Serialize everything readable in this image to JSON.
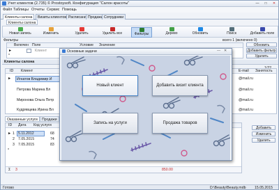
{
  "window": {
    "title": "Учет клиентов (2.735) © Prostoysoft. Конфигурация \"Салон красоты\"",
    "minimize": "—",
    "maximize": "□",
    "close": "✕"
  },
  "menu": [
    "Файл",
    "Таблицы",
    "Отчеты",
    "Сервис",
    "Помощь"
  ],
  "tabs": [
    "Клиенты салона",
    "Визиты клиентов",
    "Расписание",
    "Продажи",
    "Сотрудники"
  ],
  "subtabs": [
    "Клиенты салона"
  ],
  "toolbar": [
    {
      "label": "Новая запись",
      "icon": "new-record-icon",
      "color": "#4caf50"
    },
    {
      "label": "Изменить",
      "icon": "edit-icon",
      "color": "#e6a23c"
    },
    {
      "label": "Удалить",
      "icon": "delete-icon",
      "color": "#e53935"
    },
    {
      "label": "Удалить все",
      "icon": "delete-all-icon",
      "color": "#c62828"
    },
    {
      "label": "Фильтры",
      "icon": "filter-icon",
      "color": "#2e7d32"
    },
    {
      "label": "Дерево",
      "icon": "tree-icon",
      "color": "#43a047"
    },
    {
      "label": "Обновить",
      "icon": "refresh-icon",
      "color": "#1e88e5"
    },
    {
      "label": "Поиск",
      "icon": "search-icon",
      "color": "#546e7a"
    },
    {
      "label": "Добавить поле",
      "icon": "add-field-icon",
      "color": "#3949ab"
    }
  ],
  "filters": {
    "label": "Фильтры",
    "columns": [
      "Включен",
      "Поле",
      "Условие",
      "Значение"
    ],
    "row": {
      "field": "Клиент"
    },
    "count_text": "всего 1 (включено 0)",
    "update_btn": "Обновить",
    "add_btn": "Добавить фильтр",
    "delete_btn": "Удалить"
  },
  "clients": {
    "label": "Клиенты салона",
    "page": "1/22",
    "columns": [
      "ID",
      "Клиент",
      "E-mail",
      "Занятость"
    ],
    "rows": [
      {
        "name": "Игнатов Владимир И",
        "email": "@mail.ru"
      },
      {
        "name": "Петрова Марина Вл",
        "email": "@mail.ru"
      },
      {
        "name": "Миронова Ольга Петр",
        "email": "@mail.ru"
      },
      {
        "name": "Кудрявцева Ирина Вл",
        "email": "@mail.ru"
      }
    ]
  },
  "services": {
    "tabs": [
      "Оказанные услуги",
      "Продажи"
    ],
    "columns": [
      "ID",
      "Дата",
      "Код услуги"
    ],
    "rows": [
      {
        "id": "1",
        "date": "5.11.2012",
        "code": "68"
      },
      {
        "id": "2",
        "date": "7.05.2015",
        "code": "74"
      },
      {
        "id": "3",
        "date": "7.05.2015",
        "code": "83"
      }
    ],
    "sum_label": "Σ",
    "sum_count": "3",
    "sum_value": "850.00",
    "add_btn": "Добавить",
    "edit_btn": "Изменить",
    "delete_btn": "Удалить"
  },
  "modal": {
    "title": "Основные задачи",
    "buttons": [
      "Новый клиент",
      "Добавить визит клиента",
      "Запись на услуги",
      "Продажа товаров"
    ],
    "background": "#c9d3e4"
  },
  "status": {
    "ready": "Готово",
    "path": "D:\\Beauty\\Beauty.mdb",
    "date": "15.05.2015"
  }
}
